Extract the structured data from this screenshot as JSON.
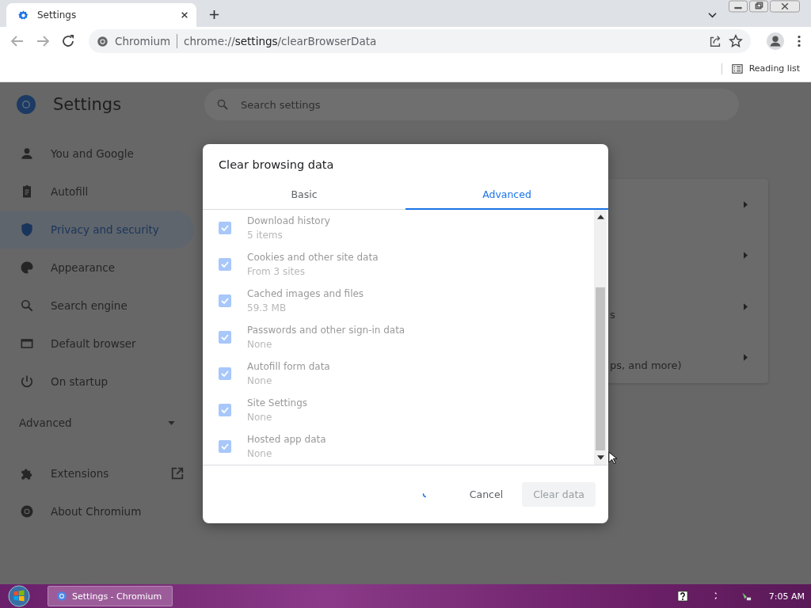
{
  "browser": {
    "tab": {
      "title": "Settings",
      "selected": true
    },
    "omnibox": {
      "site": "Chromium",
      "url": "chrome://**settings**/clearBrowserData"
    },
    "reading_list": "Reading list"
  },
  "settings": {
    "title": "Settings",
    "search": {
      "placeholder": "Search settings"
    },
    "nav": [
      {
        "kind": "item",
        "label": "You and Google",
        "selected": false
      },
      {
        "kind": "item",
        "label": "Autofill",
        "selected": false
      },
      {
        "kind": "item",
        "label": "Privacy and security",
        "selected": true
      },
      {
        "kind": "item",
        "label": "Appearance",
        "selected": false
      },
      {
        "kind": "item",
        "label": "Search engine",
        "selected": false
      },
      {
        "kind": "item",
        "label": "Default browser",
        "selected": false
      },
      {
        "kind": "item",
        "label": "On startup",
        "selected": false
      },
      {
        "kind": "section",
        "label": "Advanced",
        "expanded": false
      },
      {
        "kind": "item",
        "label": "Extensions",
        "selected": false,
        "external": true
      },
      {
        "kind": "item",
        "label": "About Chromium",
        "selected": false
      }
    ],
    "card_fragments": [
      "s",
      "ps, and more)"
    ]
  },
  "dialog": {
    "title": "Clear browsing data",
    "tabs": [
      {
        "label": "Basic",
        "selected": false
      },
      {
        "label": "Advanced",
        "selected": true
      }
    ],
    "items": [
      {
        "title": "Download history",
        "detail": "5 items",
        "checked": true,
        "disabled": true
      },
      {
        "title": "Cookies and other site data",
        "detail": "From 3 sites",
        "checked": true,
        "disabled": true
      },
      {
        "title": "Cached images and files",
        "detail": "59.3 MB",
        "checked": true,
        "disabled": true
      },
      {
        "title": "Passwords and other sign-in data",
        "detail": "None",
        "checked": true,
        "disabled": true
      },
      {
        "title": "Autofill form data",
        "detail": "None",
        "checked": true,
        "disabled": true
      },
      {
        "title": "Site Settings",
        "detail": "None",
        "checked": true,
        "disabled": true
      },
      {
        "title": "Hosted app data",
        "detail": "None",
        "checked": true,
        "disabled": true
      }
    ],
    "busy": true,
    "buttons": [
      {
        "kind": "text",
        "label": "Cancel",
        "disabled": false
      },
      {
        "kind": "filled",
        "label": "Clear data",
        "disabled": true
      }
    ]
  },
  "taskbar": {
    "window": {
      "label": "Settings - Chromium",
      "selected": true
    },
    "clock": "7:05 AM"
  }
}
